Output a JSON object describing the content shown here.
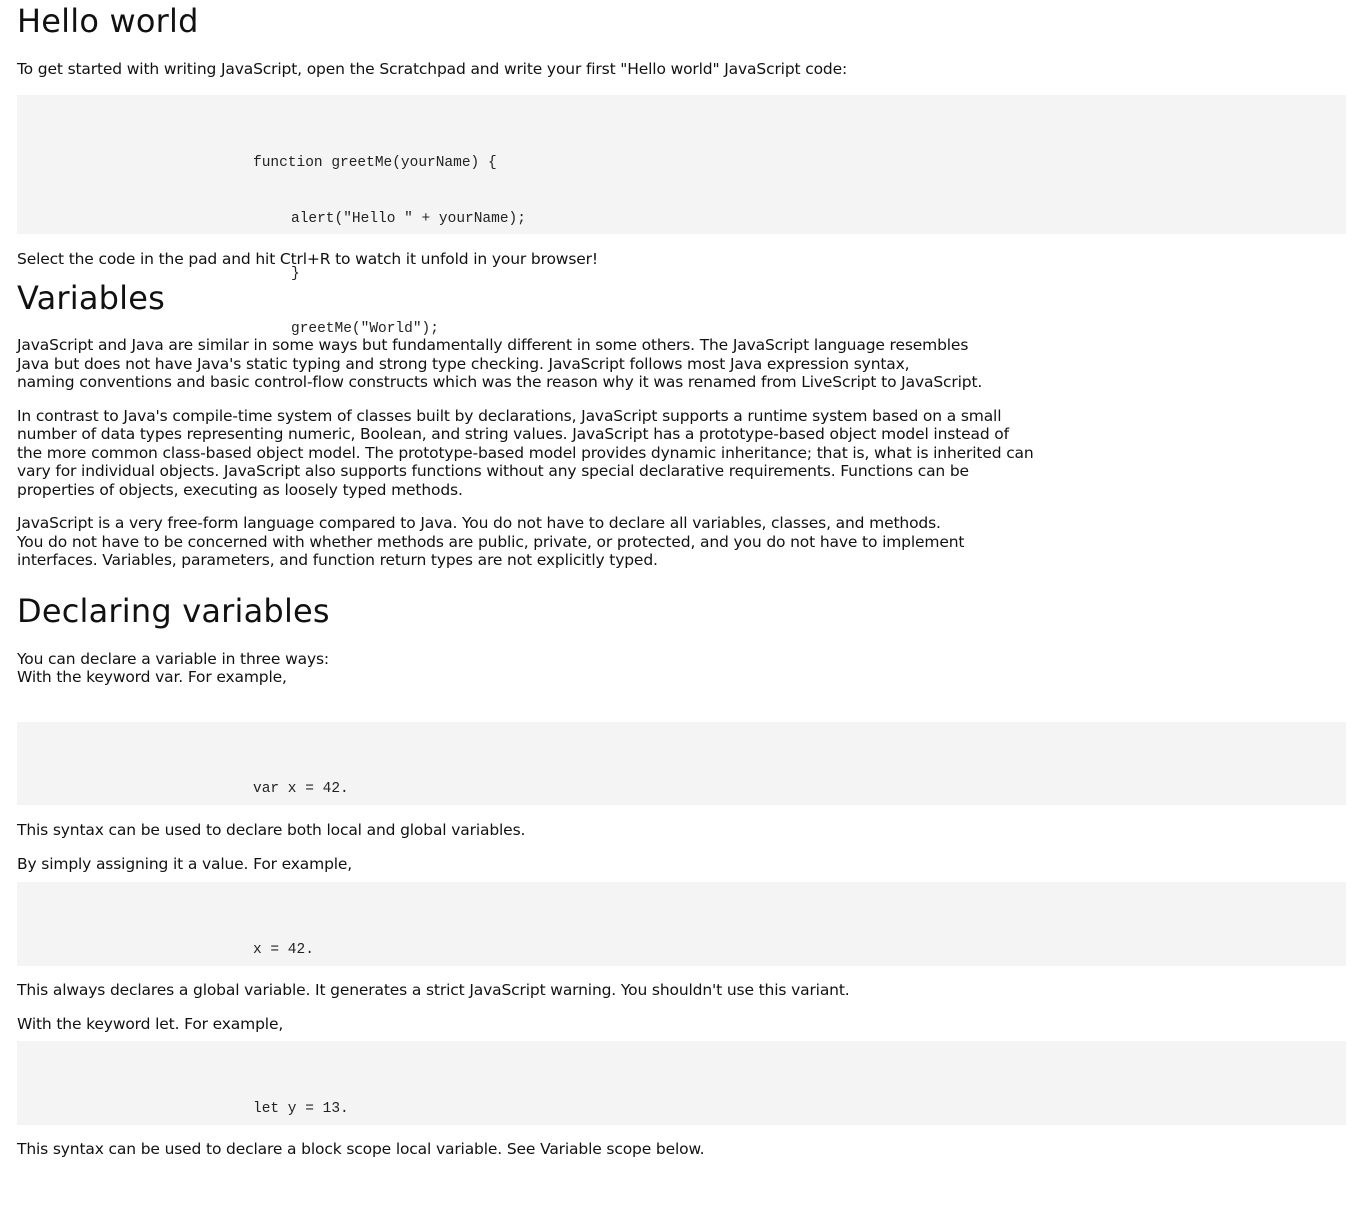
{
  "sections": {
    "hello": {
      "title": "Hello world",
      "intro": "To get started with writing JavaScript, open the Scratchpad and write your first \"Hello world\" JavaScript code:",
      "code": [
        "function greetMe(yourName) {",
        "alert(\"Hello \" + yourName);",
        "}",
        "greetMe(\"World\");"
      ],
      "after": "Select the code in the pad and hit Ctrl+R to watch it unfold in your browser!"
    },
    "variables": {
      "title": "Variables",
      "p1": [
        "JavaScript and Java are similar in some ways but fundamentally different in some others. The JavaScript language resembles",
        "Java but does not have Java's static typing and strong type checking. JavaScript follows most Java expression syntax,",
        "naming conventions and basic control-flow constructs which was the reason why it was renamed from LiveScript to JavaScript."
      ],
      "p2": [
        "In contrast to Java's compile-time system of classes built by declarations, JavaScript supports a runtime system based on a small",
        "number of data types representing numeric, Boolean, and string values. JavaScript has a prototype-based object model instead of",
        "the more common class-based object model. The prototype-based model provides dynamic inheritance; that is, what is inherited can",
        "vary for individual objects. JavaScript also supports functions without any special declarative requirements. Functions can be",
        "properties of objects, executing as loosely typed methods."
      ],
      "p3": [
        "JavaScript is a very free-form language compared to Java. You do not have to declare all variables, classes, and methods.",
        "You do not have to be concerned with whether methods are public, private, or protected, and you do not have to implement",
        "interfaces. Variables, parameters, and function return types are not explicitly typed."
      ]
    },
    "declaring": {
      "title": "Declaring variables",
      "intro": [
        "You can declare a variable in three ways:",
        "With the keyword var. For example,"
      ],
      "code_var": "var x = 42.",
      "after_var": "This syntax can be used to declare both local and global variables.",
      "assign_intro": "By simply assigning it a value. For example,",
      "code_assign": "x = 42.",
      "after_assign": "This always declares a global variable. It generates a strict JavaScript warning. You shouldn't use this variant.",
      "let_intro": "With the keyword let. For example,",
      "code_let": "let y = 13.",
      "after_let": "This syntax can be used to declare a block scope local variable. See Variable scope below."
    }
  }
}
